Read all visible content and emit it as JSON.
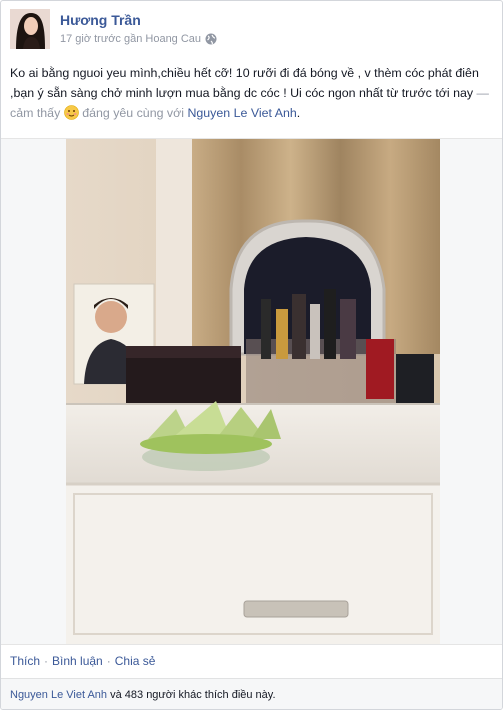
{
  "post": {
    "author": "Hương Trần",
    "meta": "17 giờ trước gần Hoang Cau",
    "text_main": "Ko ai bằng nguoi yeu mình,chiều hết cỡ! 10 rưỡi đi đá bóng về , v thèm cóc phát điên ,bạn ý sẵn sàng chở minh lượn mua bằng dc cóc ! Ui cóc ngon nhất từ trước tới nay",
    "feeling_prefix": "— cảm thấy",
    "feeling": "đáng yêu cùng với",
    "tagged": "Nguyen Le Viet Anh",
    "tagged_suffix": "."
  },
  "actions": {
    "like": "Thích",
    "comment": "Bình luận",
    "share": "Chia sẻ",
    "separator": "·"
  },
  "likes": {
    "names": "Nguyen Le Viet Anh",
    "rest": "và 483 người khác thích điều này."
  },
  "colors": {
    "link": "#3b5998",
    "muted": "#9197a3",
    "bar": "#f6f7f8"
  }
}
